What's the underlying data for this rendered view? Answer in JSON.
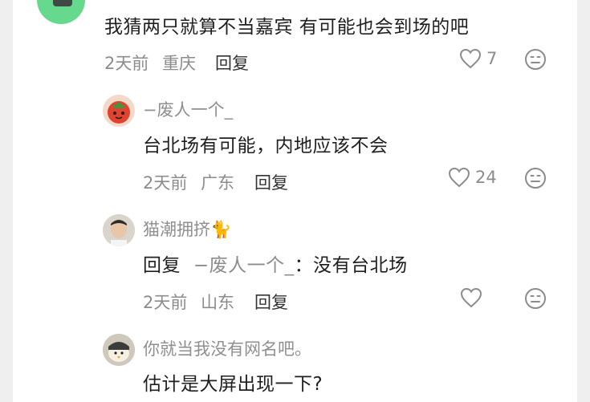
{
  "comments": [
    {
      "text": "我猜两只就算不当嘉宾 有可能也会到场的吧",
      "time": "2天前",
      "location": "重庆",
      "reply_label": "回复",
      "likes": "7"
    }
  ],
  "replies": [
    {
      "nickname": "−废人一个_",
      "text": "台北场有可能，内地应该不会",
      "time": "2天前",
      "location": "广东",
      "reply_label": "回复",
      "likes": "24"
    },
    {
      "nickname": "猫潮拥挤🐈",
      "reply_prefix": "回复",
      "reply_to": "−废人一个_",
      "reply_sep": "：",
      "reply_body": "没有台北场",
      "time": "2天前",
      "location": "山东",
      "reply_label": "回复",
      "likes": ""
    },
    {
      "nickname": "你就当我没有网名吧。",
      "text": "估计是大屏出现一下?"
    }
  ],
  "icons": {
    "like": "heart-outline-icon",
    "dislike": "unhappy-face-icon"
  }
}
